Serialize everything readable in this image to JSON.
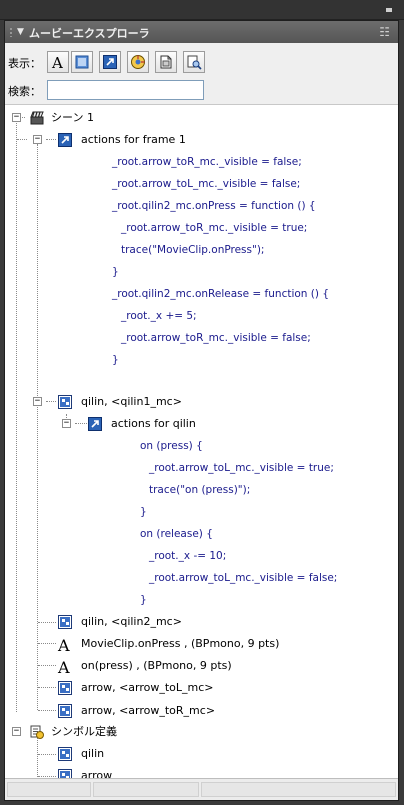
{
  "panel": {
    "title": "ムービーエクスプローラ"
  },
  "toolbar": {
    "show_label": "表示：",
    "filters": [
      {
        "name": "text-filter",
        "icon": "letter-a-icon"
      },
      {
        "name": "button-filter",
        "icon": "button-icon"
      },
      {
        "name": "action-filter",
        "icon": "action-script-icon"
      },
      {
        "name": "video-filter",
        "icon": "video-sound-icon"
      },
      {
        "name": "frame-filter",
        "icon": "frame-icon"
      },
      {
        "name": "custom-filter",
        "icon": "customize-icon"
      }
    ]
  },
  "search": {
    "label": "検索：",
    "value": ""
  },
  "tree": {
    "scene": "シーン 1",
    "actions_frame": "actions for frame 1",
    "code1": [
      "_root.arrow_toR_mc._visible = false;",
      "_root.arrow_toL_mc._visible = false;",
      "_root.qilin2_mc.onPress = function () {",
      "_root.arrow_toR_mc._visible = true;",
      "trace(\"MovieClip.onPress\");",
      "}",
      "_root.qilin2_mc.onRelease = function () {",
      "_root._x += 5;",
      "_root.arrow_toR_mc._visible = false;",
      "}"
    ],
    "qilin1": "qilin, <qilin1_mc>",
    "actions_qilin": "actions for qilin",
    "code2": [
      "on (press) {",
      "_root.arrow_toL_mc._visible = true;",
      "trace(\"on (press)\");",
      "}",
      "on (release) {",
      "_root._x -= 10;",
      "_root.arrow_toL_mc._visible = false;",
      "}"
    ],
    "qilin2": "qilin, <qilin2_mc>",
    "text1": "MovieClip.onPress , (BPmono, 9 pts)",
    "text2": "on(press) , (BPmono, 9 pts)",
    "arrow_l": "arrow, <arrow_toL_mc>",
    "arrow_r": "arrow, <arrow_toR_mc>",
    "symbols": "シンボル定義",
    "sym1": "qilin",
    "sym2": "arrow"
  },
  "colors": {
    "code_text": "#1a1a8c",
    "panel_title_bg": "#5f5f5f",
    "action_icon": "#2b63b6"
  }
}
